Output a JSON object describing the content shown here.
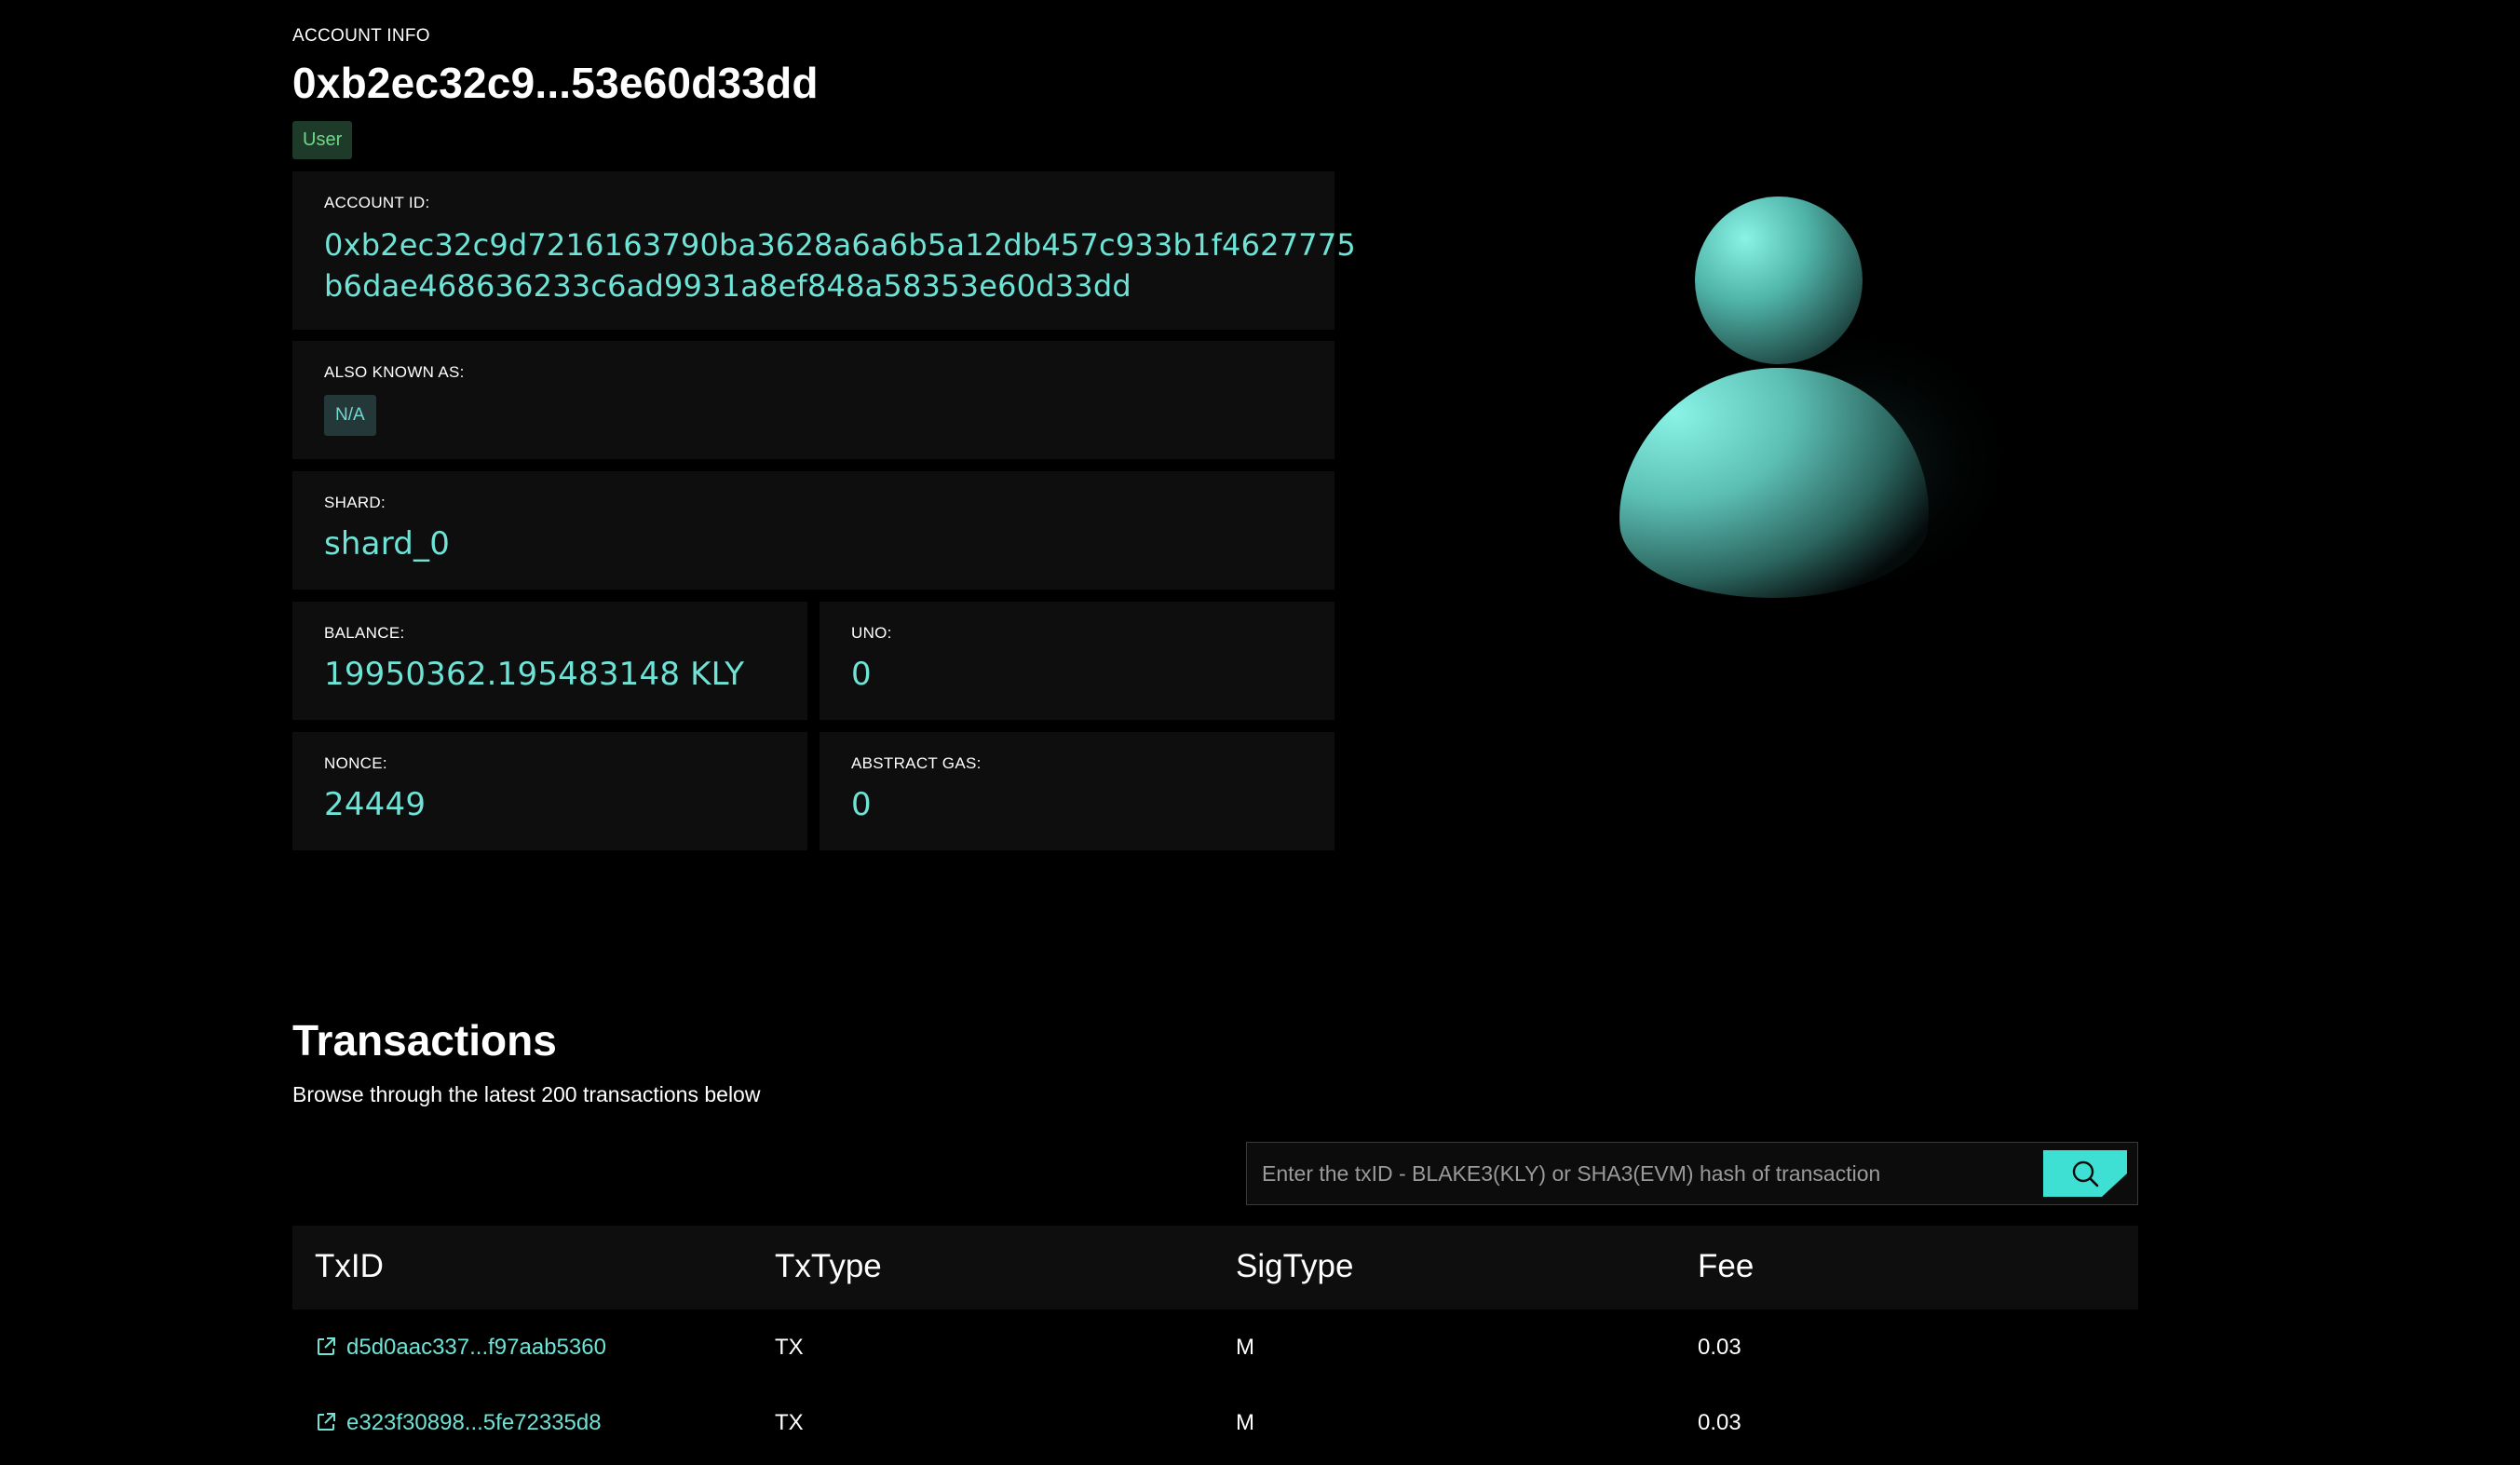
{
  "account": {
    "eyebrow": "ACCOUNT INFO",
    "title": "0xb2ec32c9...53e60d33dd",
    "role_badge": "User"
  },
  "cards": {
    "account_id": {
      "label": "ACCOUNT ID:",
      "line1": "0xb2ec32c9d7216163790ba3628a6a6b5a12db457c933b1f4627775",
      "line2": "b6dae468636233c6ad9931a8ef848a58353e60d33dd"
    },
    "aka": {
      "label": "ALSO KNOWN AS:",
      "value": "N/A"
    },
    "shard": {
      "label": "SHARD:",
      "value": "shard_0"
    },
    "balance": {
      "label": "BALANCE:",
      "value": "19950362.195483148 KLY"
    },
    "uno": {
      "label": "UNO:",
      "value": "0"
    },
    "nonce": {
      "label": "NONCE:",
      "value": "24449"
    },
    "abstract_gas": {
      "label": "ABSTRACT GAS:",
      "value": "0"
    }
  },
  "avatar": {
    "icon": "user-avatar-icon",
    "color": "#6ee3d6"
  },
  "transactions": {
    "title": "Transactions",
    "subtitle": "Browse through the latest 200 transactions below",
    "search": {
      "placeholder": "Enter the txID - BLAKE3(KLY) or SHA3(EVM) hash of transaction",
      "button_icon": "search-icon"
    },
    "columns": [
      "TxID",
      "TxType",
      "SigType",
      "Fee"
    ],
    "rows": [
      {
        "txid": "d5d0aac337...f97aab5360",
        "txtype": "TX",
        "sigtype": "M",
        "fee": "0.03"
      },
      {
        "txid": "e323f30898...5fe72335d8",
        "txtype": "TX",
        "sigtype": "M",
        "fee": "0.03"
      }
    ]
  },
  "colors": {
    "accent": "#6ee3d6",
    "button": "#3ee0d4",
    "card_bg": "#0e0e0e",
    "badge_bg": "#1e3b2a",
    "badge_text": "#6fd889"
  }
}
